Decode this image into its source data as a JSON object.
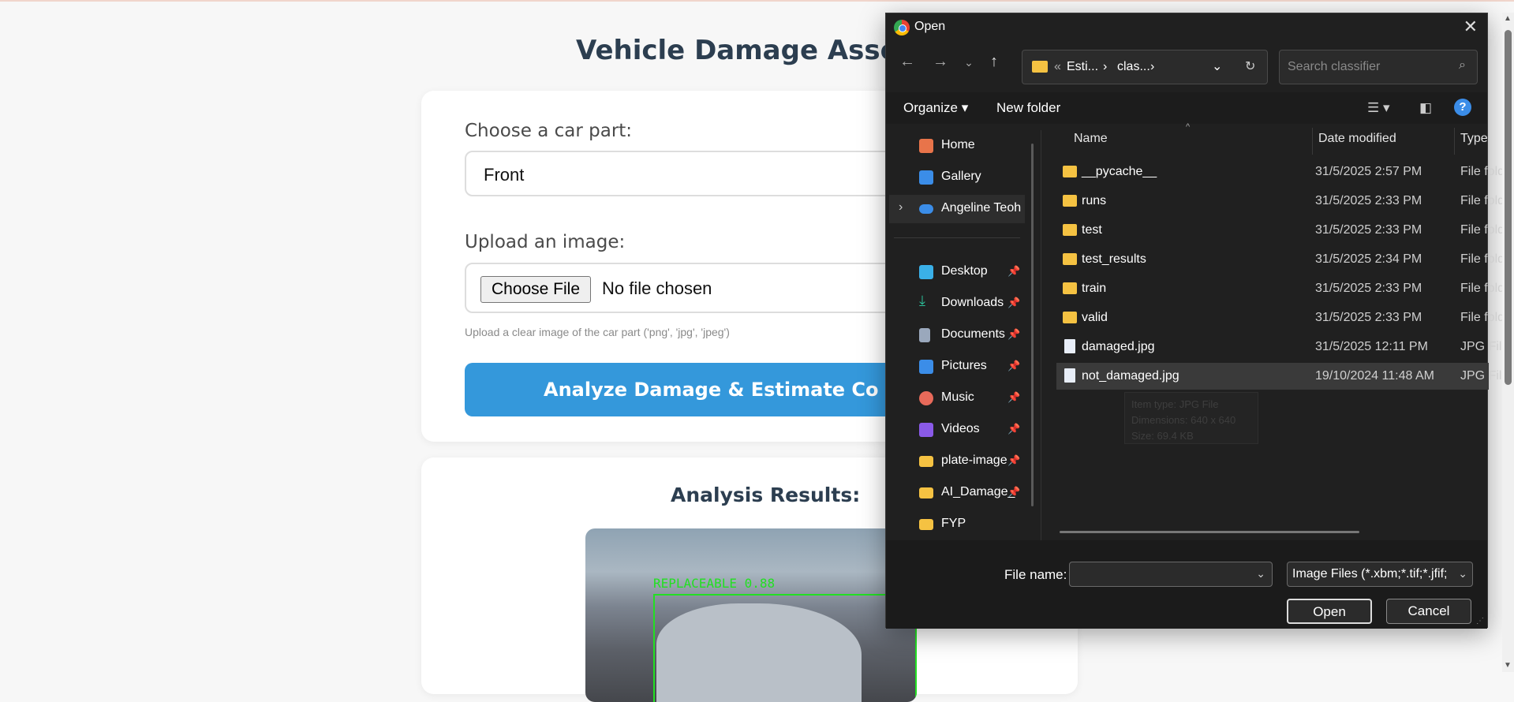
{
  "page": {
    "title": "Vehicle Damage Assessme",
    "choose_part_label": "Choose a car part:",
    "part_value": "Front",
    "upload_label": "Upload an image:",
    "choose_file_button": "Choose File",
    "file_status": "No file chosen",
    "upload_hint": "Upload a clear image of the car part ('png', 'jpg', 'jpeg')",
    "analyze_button": "Analyze Damage & Estimate Co",
    "results_title": "Analysis Results:",
    "detection_label": "REPLACEABLE 0.88"
  },
  "dialog": {
    "title": "Open",
    "breadcrumb": [
      "«",
      "Esti...",
      "clas..."
    ],
    "search_placeholder": "Search classifier",
    "organize": "Organize",
    "new_folder": "New folder",
    "nav_items": [
      {
        "label": "Home",
        "icon": "home-icon",
        "color": "#e8744a"
      },
      {
        "label": "Gallery",
        "icon": "gallery-icon",
        "color": "#3b8de8"
      },
      {
        "label": "Angeline Teoh - Personal",
        "icon": "onedrive-icon",
        "color": "#3b8de8"
      },
      {
        "label": "Desktop",
        "icon": "desktop-icon",
        "color": "#3ab0e8"
      },
      {
        "label": "Downloads",
        "icon": "download-icon",
        "color": "#2cc09a"
      },
      {
        "label": "Documents",
        "icon": "documents-icon",
        "color": "#9aa8bc"
      },
      {
        "label": "Pictures",
        "icon": "pictures-icon",
        "color": "#3b8de8"
      },
      {
        "label": "Music",
        "icon": "music-icon",
        "color": "#e86a5a"
      },
      {
        "label": "Videos",
        "icon": "videos-icon",
        "color": "#8a5ae8"
      },
      {
        "label": "plate-images",
        "icon": "folder-icon",
        "color": "#f5c242"
      },
      {
        "label": "AI_Damage_",
        "icon": "folder-icon",
        "color": "#f5c242"
      },
      {
        "label": "FYP",
        "icon": "folder-icon",
        "color": "#f5c242"
      }
    ],
    "columns": {
      "name": "Name",
      "date": "Date modified",
      "type": "Type"
    },
    "files": [
      {
        "name": "__pycache__",
        "date": "31/5/2025 2:57 PM",
        "type": "File folder"
      },
      {
        "name": "runs",
        "date": "31/5/2025 2:33 PM",
        "type": "File folder"
      },
      {
        "name": "test",
        "date": "31/5/2025 2:33 PM",
        "type": "File folder"
      },
      {
        "name": "test_results",
        "date": "31/5/2025 2:34 PM",
        "type": "File folder"
      },
      {
        "name": "train",
        "date": "31/5/2025 2:33 PM",
        "type": "File folder"
      },
      {
        "name": "valid",
        "date": "31/5/2025 2:33 PM",
        "type": "File folder"
      },
      {
        "name": "damaged.jpg",
        "date": "31/5/2025 12:11 PM",
        "type": "JPG File"
      },
      {
        "name": "not_damaged.jpg",
        "date": "19/10/2024 11:48 AM",
        "type": "JPG File"
      }
    ],
    "tooltip": [
      "Item type: JPG File",
      "Dimensions: 640 x 640",
      "Size: 69.4 KB"
    ],
    "file_name_label": "File name:",
    "file_name_value": "",
    "file_type_filter": "Image Files (*.xbm;*.tif;*.jfif;",
    "open_button": "Open",
    "cancel_button": "Cancel"
  }
}
